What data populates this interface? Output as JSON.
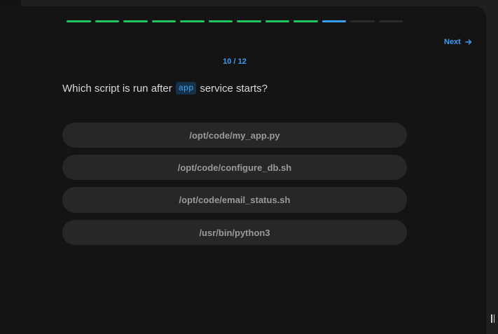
{
  "progress": {
    "total": 12,
    "completed": 9,
    "current_index": 10,
    "colors": {
      "done": "#22c55e",
      "current": "#3b9ef5",
      "pending": "#2a2a2a"
    }
  },
  "nav": {
    "next_label": "Next",
    "next_icon": "arrow-right-icon"
  },
  "counter": "10 / 12",
  "question": {
    "before": "Which script is run after",
    "code": "app",
    "after": "service starts?"
  },
  "options": [
    {
      "label": "/opt/code/my_app.py"
    },
    {
      "label": "/opt/code/configure_db.sh"
    },
    {
      "label": "/opt/code/email_status.sh"
    },
    {
      "label": "/usr/bin/python3"
    }
  ]
}
